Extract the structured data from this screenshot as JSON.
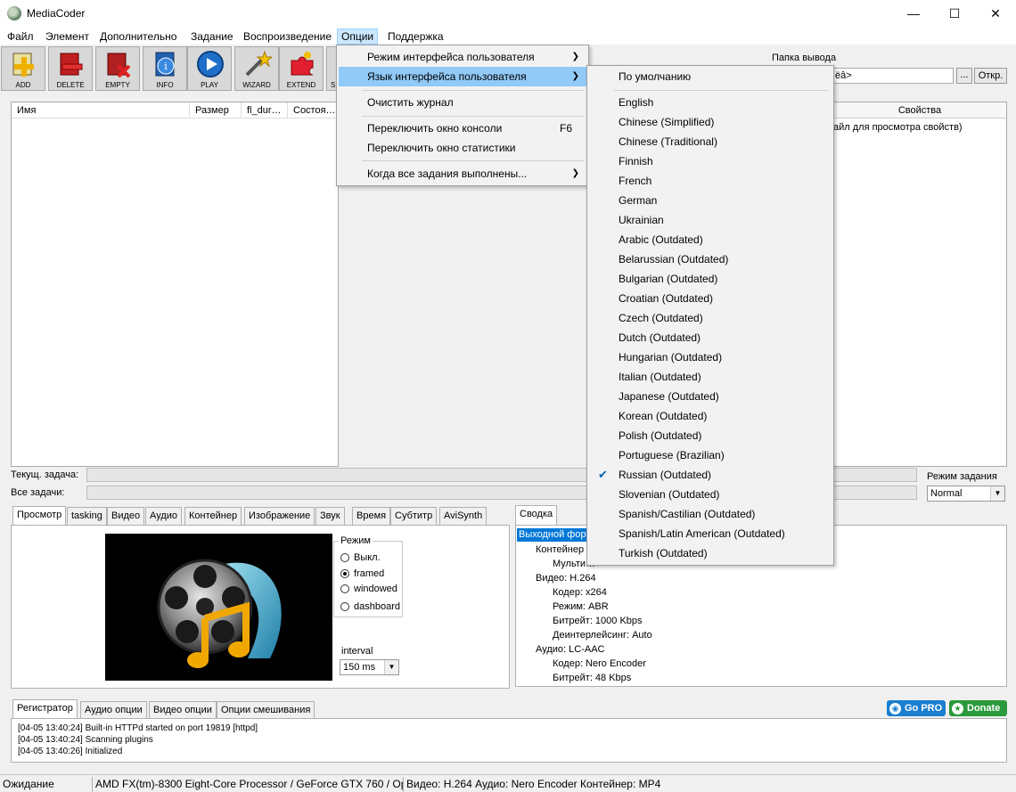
{
  "window": {
    "title": "MediaCoder",
    "minimize": "—",
    "maximize": "☐",
    "close": "✕"
  },
  "menubar": [
    "Файл",
    "Элемент",
    "Дополнительно",
    "Задание",
    "Воспроизведение",
    "Опции",
    "Поддержка"
  ],
  "toolbar": [
    {
      "label": "ADD",
      "icon": "add-icon"
    },
    {
      "label": "DELETE",
      "icon": "delete-icon"
    },
    {
      "label": "EMPTY",
      "icon": "empty-icon"
    },
    {
      "label": "INFO",
      "icon": "info-icon"
    },
    {
      "label": "PLAY",
      "icon": "play-icon"
    },
    {
      "label": "WIZARD",
      "icon": "wizard-icon"
    },
    {
      "label": "EXTEND",
      "icon": "extend-icon"
    },
    {
      "label": "S",
      "icon": "settings-icon"
    }
  ],
  "filelist": {
    "columns": [
      "Имя",
      "Размер",
      "fl_dur…",
      "Состоя…"
    ]
  },
  "output": {
    "label": "Папка вывода",
    "path": "ëâ>",
    "browse": "...",
    "open": "Откр."
  },
  "properties": {
    "header": "Свойства",
    "hint": "айл для просмотра свойств)"
  },
  "progress": {
    "current_label": "Текущ. задача:",
    "all_label": "Все задачи:",
    "mode_label": "Режим задания",
    "mode_value": "Normal"
  },
  "left_tabs": [
    "Просмотр",
    "tasking",
    "Видео",
    "Аудио",
    "Контейнер",
    "Изображение",
    "Звук",
    "Время",
    "Субтитр",
    "AviSynth"
  ],
  "preview": {
    "mode_title": "Режим",
    "modes": [
      {
        "label": "Выкл.",
        "selected": false
      },
      {
        "label": "framed",
        "selected": true
      },
      {
        "label": "windowed",
        "selected": false
      },
      {
        "label": "dashboard",
        "selected": false
      }
    ],
    "interval_label": "interval",
    "interval_value": "150 ms"
  },
  "summary": {
    "tab": "Сводка",
    "root": "Выходной фор",
    "lines": [
      {
        "text": "Контейнер",
        "indent": 1
      },
      {
        "text": "Мульти…",
        "indent": 2
      },
      {
        "text": "Видео: H.264",
        "indent": 1
      },
      {
        "text": "Кодер: x264",
        "indent": 2
      },
      {
        "text": "Режим: ABR",
        "indent": 2
      },
      {
        "text": "Битрейт: 1000 Kbps",
        "indent": 2
      },
      {
        "text": "Деинтерлейсинг: Auto",
        "indent": 2
      },
      {
        "text": "Аудио: LC-AAC",
        "indent": 1
      },
      {
        "text": "Кодер: Nero Encoder",
        "indent": 2
      },
      {
        "text": "Битрейт: 48 Kbps",
        "indent": 2
      }
    ]
  },
  "log_tabs": [
    "Регистратор",
    "Аудио опции",
    "Видео опции",
    "Опции смешивания"
  ],
  "log_lines": [
    "[04-05 13:40:24] Built-in HTTPd started on port 19819 [httpd]",
    "[04-05 13:40:24] Scanning plugins",
    "[04-05 13:40:26] Initialized"
  ],
  "badges": {
    "gopro": "Go PRO",
    "donate": "Donate"
  },
  "statusbar": {
    "state": "Ожидание",
    "hardware": "AMD FX(tm)-8300 Eight-Core Processor  / GeForce GTX 760 / Ope",
    "codecs": "Видео: H.264  Аудио: Nero Encoder  Контейнер: MP4"
  },
  "options_menu": [
    {
      "label": "Режим интерфейса пользователя",
      "submenu": true,
      "shortcut": ""
    },
    {
      "label": "Язык интерфейса пользователя",
      "submenu": true,
      "shortcut": "",
      "highlighted": true
    },
    {
      "label": "Очистить журнал",
      "submenu": false,
      "shortcut": ""
    },
    {
      "label": "Переключить окно консоли",
      "submenu": false,
      "shortcut": "F6"
    },
    {
      "label": "Переключить окно статистики",
      "submenu": false,
      "shortcut": ""
    },
    {
      "label": "Когда все задания выполнены...",
      "submenu": true,
      "shortcut": ""
    }
  ],
  "language_menu": {
    "default": "По умолчанию",
    "items": [
      {
        "label": "English",
        "checked": false
      },
      {
        "label": "Chinese (Simplified)",
        "checked": false
      },
      {
        "label": "Chinese (Traditional)",
        "checked": false
      },
      {
        "label": "Finnish",
        "checked": false
      },
      {
        "label": "French",
        "checked": false
      },
      {
        "label": "German",
        "checked": false
      },
      {
        "label": "Ukrainian",
        "checked": false
      },
      {
        "label": "Arabic (Outdated)",
        "checked": false
      },
      {
        "label": "Belarussian (Outdated)",
        "checked": false
      },
      {
        "label": "Bulgarian (Outdated)",
        "checked": false
      },
      {
        "label": "Croatian (Outdated)",
        "checked": false
      },
      {
        "label": "Czech (Outdated)",
        "checked": false
      },
      {
        "label": "Dutch (Outdated)",
        "checked": false
      },
      {
        "label": "Hungarian (Outdated)",
        "checked": false
      },
      {
        "label": "Italian (Outdated)",
        "checked": false
      },
      {
        "label": "Japanese (Outdated)",
        "checked": false
      },
      {
        "label": "Korean (Outdated)",
        "checked": false
      },
      {
        "label": "Polish (Outdated)",
        "checked": false
      },
      {
        "label": "Portuguese (Brazilian)",
        "checked": false
      },
      {
        "label": "Russian (Outdated)",
        "checked": true
      },
      {
        "label": "Slovenian (Outdated)",
        "checked": false
      },
      {
        "label": "Spanish/Castilian (Outdated)",
        "checked": false
      },
      {
        "label": "Spanish/Latin American (Outdated)",
        "checked": false
      },
      {
        "label": "Turkish (Outdated)",
        "checked": false
      }
    ]
  },
  "colors": {
    "menu_highlight": "#91c9f7",
    "selection": "#0078d7",
    "gopro": "#1a7fd0",
    "donate": "#2a9a3c"
  }
}
